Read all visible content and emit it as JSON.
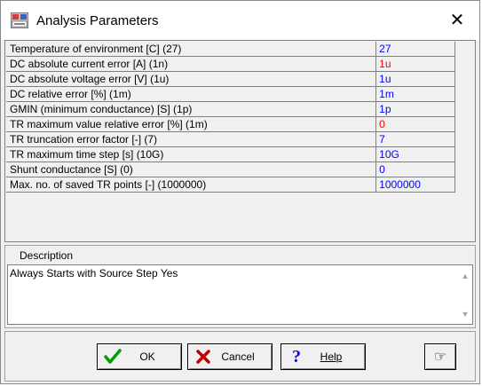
{
  "window": {
    "title": "Analysis Parameters",
    "close_glyph": "✕"
  },
  "params": [
    {
      "name": "Temperature of environment [C]  (27)",
      "value": "27",
      "color": "#0000ff"
    },
    {
      "name": "DC absolute current error [A]  (1n)",
      "value": "1u",
      "color": "#ff0000"
    },
    {
      "name": "DC absolute voltage error [V]  (1u)",
      "value": "1u",
      "color": "#0000ff"
    },
    {
      "name": "DC relative error [%]  (1m)",
      "value": "1m",
      "color": "#0000ff"
    },
    {
      "name": "GMIN (minimum conductance) [S]  (1p)",
      "value": "1p",
      "color": "#0000ff"
    },
    {
      "name": "TR maximum value relative error [%]  (1m)",
      "value": "0",
      "color": "#ff0000"
    },
    {
      "name": "TR truncation error factor [-]  (7)",
      "value": "7",
      "color": "#0000ff"
    },
    {
      "name": "TR maximum time step [s]  (10G)",
      "value": "10G",
      "color": "#0000ff"
    },
    {
      "name": "Shunt conductance [S]  (0)",
      "value": "0",
      "color": "#0000ff"
    },
    {
      "name": "Max. no. of saved TR points [-]  (1000000)",
      "value": "1000000",
      "color": "#0000ff"
    }
  ],
  "description": {
    "label": "Description",
    "text": "Always Starts with Source Step Yes"
  },
  "buttons": {
    "ok": {
      "label": "OK",
      "icon": "checkmark-icon"
    },
    "cancel": {
      "label": "Cancel",
      "icon": "x-icon"
    },
    "help": {
      "label": "Help",
      "icon": "question-icon"
    },
    "pointer": {
      "icon": "pointing-hand-icon"
    }
  }
}
